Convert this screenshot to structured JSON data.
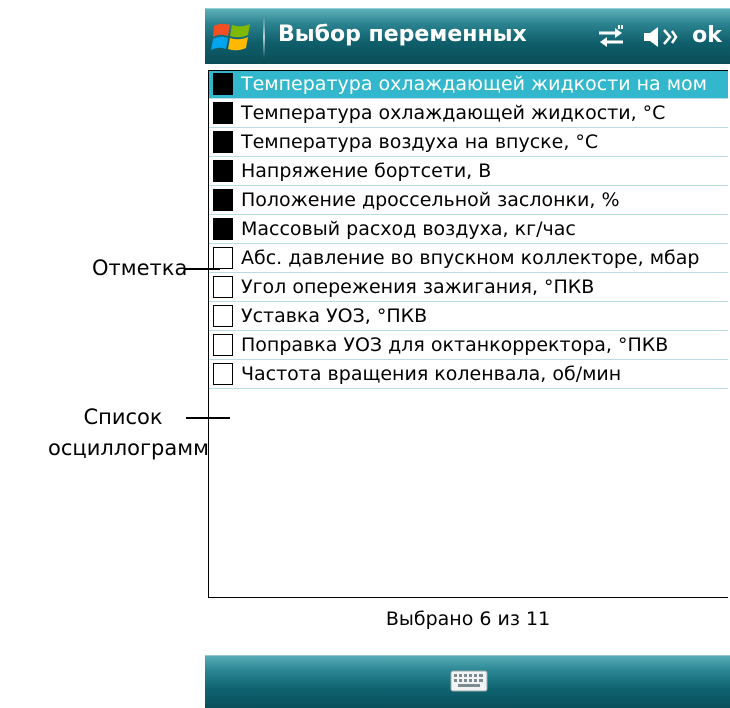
{
  "window": {
    "title": "Выбор переменных",
    "ok_label": "ok",
    "icons": [
      "windows-start-icon",
      "connectivity-icon",
      "volume-icon",
      "keyboard-icon"
    ]
  },
  "variables": [
    {
      "label": "Температура охлаждающей жидкости на мом",
      "checked": true,
      "selected": true
    },
    {
      "label": "Температура охлаждающей жидкости, °C",
      "checked": true,
      "selected": false
    },
    {
      "label": "Температура воздуха на впуске, °C",
      "checked": true,
      "selected": false
    },
    {
      "label": "Напряжение бортсети, В",
      "checked": true,
      "selected": false
    },
    {
      "label": "Положение дроссельной заслонки, %",
      "checked": true,
      "selected": false
    },
    {
      "label": "Массовый расход воздуха, кг/час",
      "checked": true,
      "selected": false
    },
    {
      "label": "Абс. давление во впускном коллекторе, мбар",
      "checked": false,
      "selected": false
    },
    {
      "label": "Угол опережения зажигания, °ПКВ",
      "checked": false,
      "selected": false
    },
    {
      "label": "Уставка УОЗ, °ПКВ",
      "checked": false,
      "selected": false
    },
    {
      "label": "Поправка УОЗ для октанкорректора, °ПКВ",
      "checked": false,
      "selected": false
    },
    {
      "label": "Частота вращения коленвала, об/мин",
      "checked": false,
      "selected": false
    }
  ],
  "status": "Выбрано 6 из 11",
  "annotations": {
    "checkbox_label": "Отметка",
    "list_label_line1": "Список",
    "list_label_line2": "осциллограмм"
  },
  "colors": {
    "titlebar": "#0f5f6b",
    "selection": "#33b7cc",
    "row_divider": "#b8dce3"
  }
}
